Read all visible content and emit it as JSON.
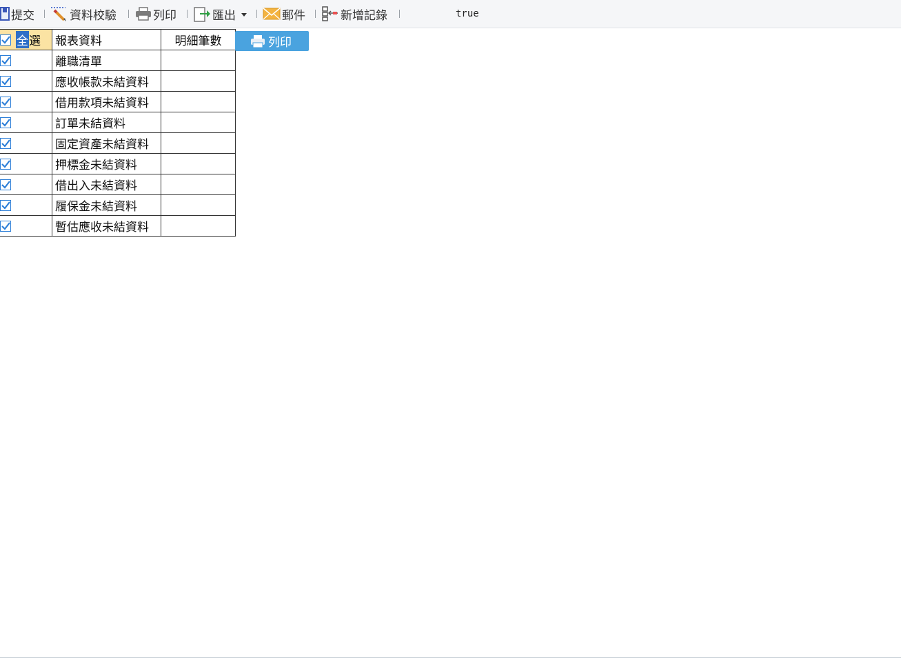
{
  "toolbar": {
    "submit": "提交",
    "validate": "資料校驗",
    "print": "列印",
    "export": "匯出",
    "mail": "郵件",
    "add_record": "新增記錄",
    "status_value": "true"
  },
  "grid": {
    "select_all_label_hl": "全",
    "select_all_label_rest": "選",
    "headers": {
      "name": "報表資料",
      "count": "明細筆數"
    },
    "rows": [
      {
        "name": "離職清單",
        "count": "",
        "checked": true
      },
      {
        "name": "應收帳款未結資料",
        "count": "",
        "checked": true
      },
      {
        "name": "借用款項未結資料",
        "count": "",
        "checked": true
      },
      {
        "name": "訂單未結資料",
        "count": "",
        "checked": true
      },
      {
        "name": "固定資產未結資料",
        "count": "",
        "checked": true
      },
      {
        "name": "押標金未結資料",
        "count": "",
        "checked": true
      },
      {
        "name": "借出入未結資料",
        "count": "",
        "checked": true
      },
      {
        "name": "履保金未結資料",
        "count": "",
        "checked": true
      },
      {
        "name": "暫估應收未結資料",
        "count": "",
        "checked": true
      }
    ]
  },
  "print_button": {
    "label": "列印"
  },
  "colors": {
    "accent": "#4aa3df",
    "header_highlight": "#fbe3a3",
    "check": "#2d7fd8"
  }
}
